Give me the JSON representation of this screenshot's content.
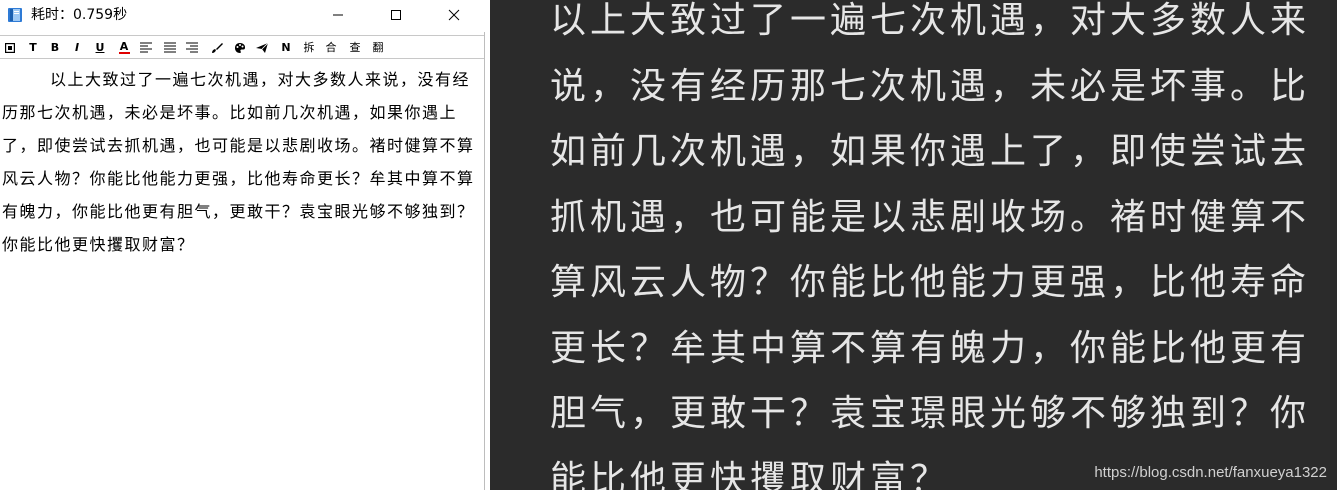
{
  "window": {
    "title": "耗时：0.759秒",
    "app_icon": "book-icon",
    "controls": [
      "minimize-icon",
      "maximize-icon",
      "close-icon"
    ]
  },
  "toolbar": {
    "buttons": [
      {
        "icon": "stop-icon",
        "label": "▣"
      },
      {
        "icon": "text-t-icon",
        "label": "T"
      },
      {
        "icon": "bold-icon",
        "label": "B"
      },
      {
        "icon": "italic-icon",
        "label": "I"
      },
      {
        "icon": "underline-icon",
        "label": "U"
      },
      {
        "icon": "font-color-icon",
        "label": "A"
      },
      {
        "icon": "align-left-icon",
        "label": ""
      },
      {
        "icon": "align-justify-icon",
        "label": ""
      },
      {
        "icon": "align-right-icon",
        "label": ""
      },
      {
        "icon": "brush-icon",
        "label": ""
      },
      {
        "icon": "palette-icon",
        "label": ""
      },
      {
        "icon": "send-icon",
        "label": ""
      },
      {
        "icon": "n-icon",
        "label": "N"
      },
      {
        "icon": "split-text",
        "label": "拆"
      },
      {
        "icon": "merge-text",
        "label": "合"
      },
      {
        "icon": "lookup-text",
        "label": "查"
      },
      {
        "icon": "translate-text",
        "label": "翻"
      }
    ],
    "colors": {
      "font_color_underline": "#e00000"
    }
  },
  "document": {
    "text": "以上大致过了一遍七次机遇，对大多数人来说，没有经历那七次机遇，未必是坏事。比如前几次机遇，如果你遇上了，即使尝试去抓机遇，也可能是以悲剧收场。褚时健算不算风云人物？你能比他能力更强，比他寿命更长？牟其中算不算有魄力，你能比他更有胆气，更敢干？袁宝眼光够不够独到？你能比他更快攫取财富？"
  },
  "preview": {
    "text": "以上大致过了一遍七次机遇，对大多数人来说，没有经历那七次机遇，未必是坏事。比如前几次机遇，如果你遇上了，即使尝试去抓机遇，也可能是以悲剧收场。褚时健算不算风云人物？你能比他能力更强，比他寿命更长？牟其中算不算有魄力，你能比他更有胆气，更敢干？袁宝璟眼光够不够独到？你能比他更快攫取财富？",
    "watermark": "https://blog.csdn.net/fanxueya1322",
    "colors": {
      "background": "#2b2b2b",
      "text": "#e6e6e6"
    }
  }
}
